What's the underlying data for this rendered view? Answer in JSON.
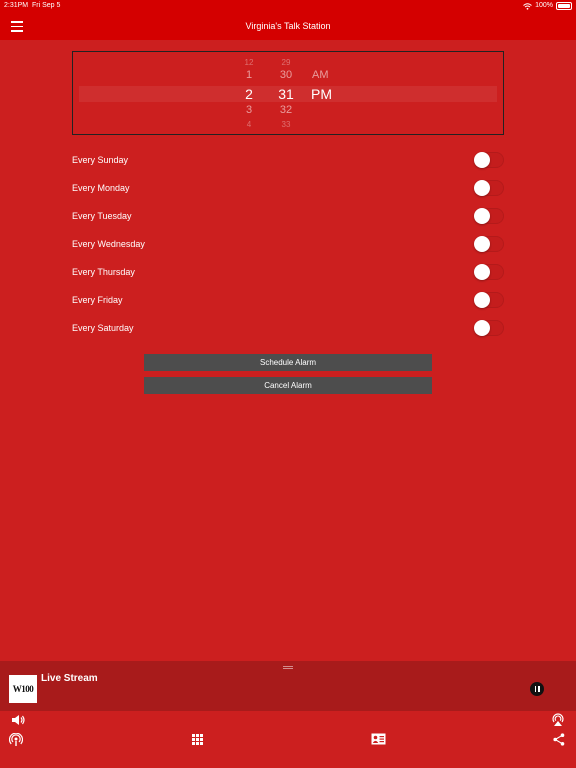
{
  "status": {
    "time": "2:31PM",
    "date": "Fri Sep 5",
    "battery": "100%"
  },
  "header": {
    "title": "Virginia's Talk Station"
  },
  "time_picker": {
    "hours": [
      "12",
      "1",
      "2",
      "3",
      "4"
    ],
    "minutes": [
      "29",
      "30",
      "31",
      "32",
      "33"
    ],
    "periods": [
      "AM",
      "PM"
    ]
  },
  "days": [
    {
      "label": "Every Sunday",
      "on": false
    },
    {
      "label": "Every Monday",
      "on": false
    },
    {
      "label": "Every Tuesday",
      "on": false
    },
    {
      "label": "Every Wednesday",
      "on": false
    },
    {
      "label": "Every Thursday",
      "on": false
    },
    {
      "label": "Every Friday",
      "on": false
    },
    {
      "label": "Every Saturday",
      "on": false
    }
  ],
  "buttons": {
    "schedule": "Schedule Alarm",
    "cancel": "Cancel Alarm"
  },
  "player": {
    "logo": "W100",
    "title": "Live Stream",
    "state": "playing"
  },
  "colors": {
    "background": "#cc1f1f",
    "bar": "#d40000",
    "player": "#a81b1b",
    "button": "#4d4d4d"
  }
}
